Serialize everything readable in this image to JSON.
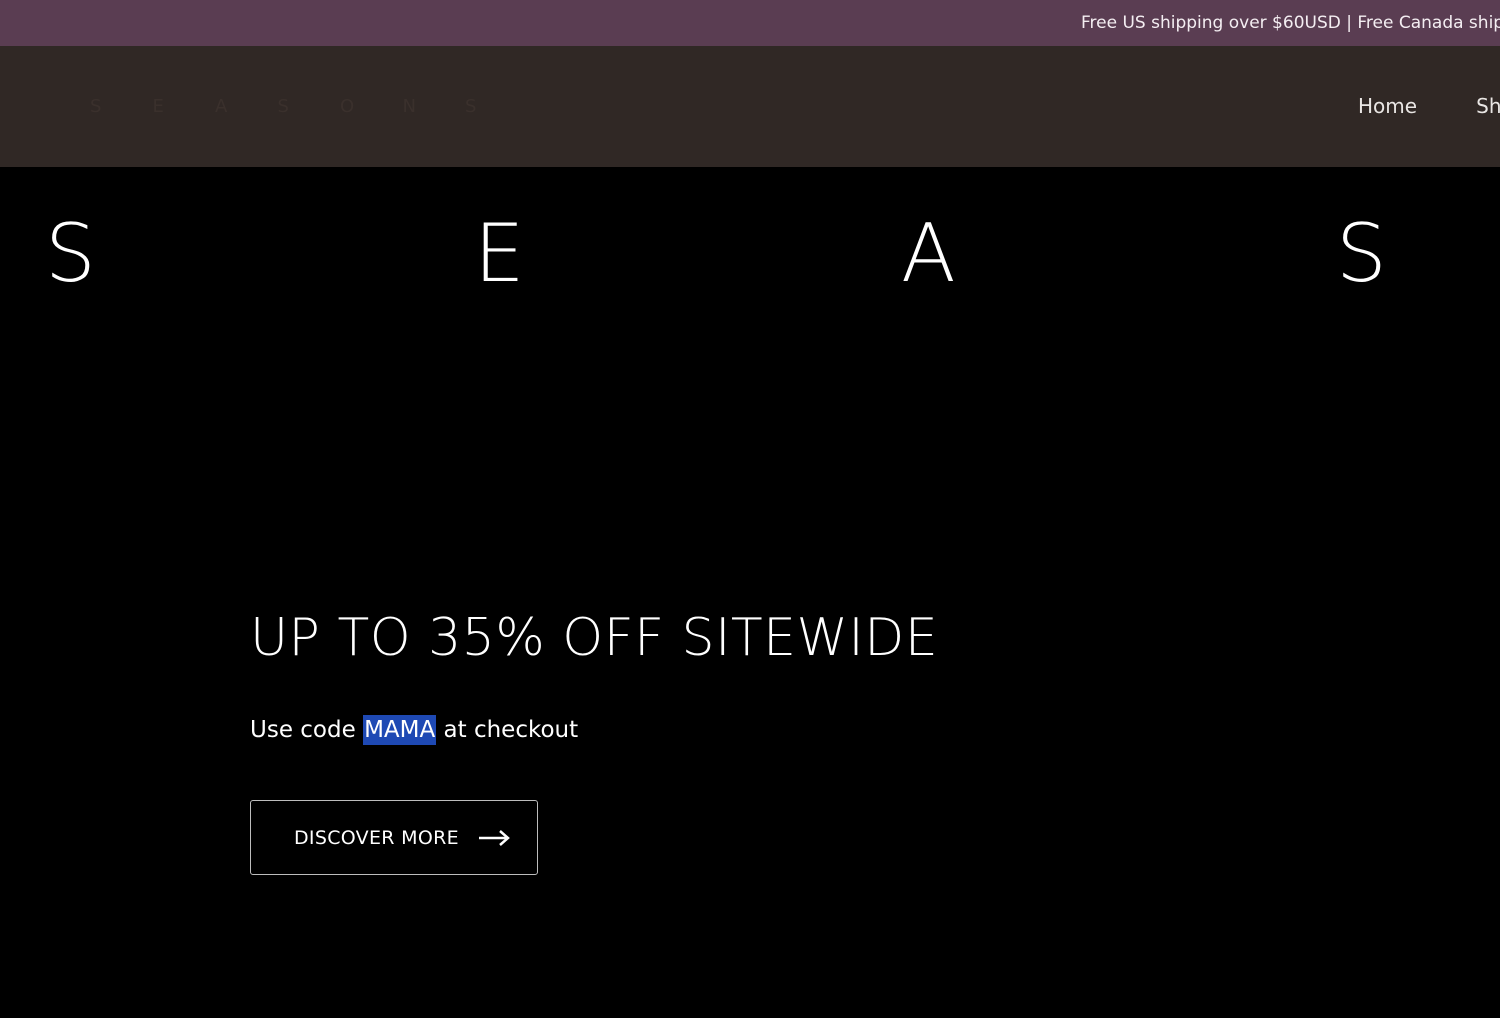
{
  "announcement": {
    "text": "Free US shipping over $60USD | Free Canada ship"
  },
  "header": {
    "logo_letters": [
      "S",
      "E",
      "A",
      "S",
      "O",
      "N",
      "S"
    ],
    "nav": [
      {
        "label": "Home"
      },
      {
        "label": "Sh"
      }
    ]
  },
  "hero": {
    "big_letters": [
      "S",
      "E",
      "A",
      "S"
    ],
    "headline": "UP TO 35% OFF SITEWIDE",
    "subline_before": "Use code",
    "code": "MAMA",
    "subline_after": "at checkout",
    "cta_label": "DISCOVER MORE",
    "cta_icon": "arrow-right-icon"
  },
  "colors": {
    "announcement_bg": "#5a3d52",
    "header_bg": "#302825",
    "hero_bg": "#000000",
    "highlight": "#1e49b4"
  }
}
